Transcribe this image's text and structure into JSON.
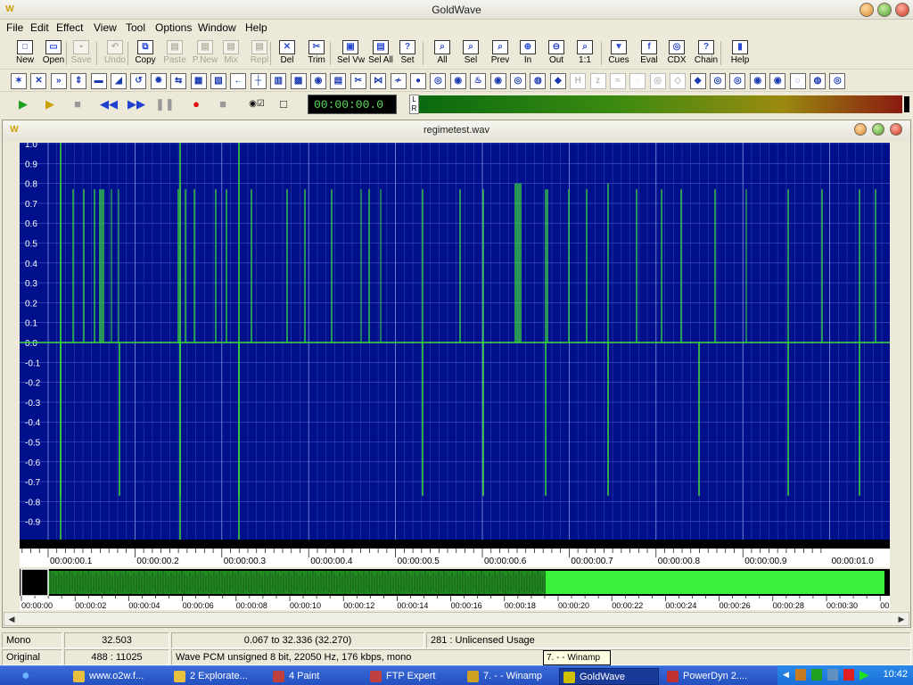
{
  "app": {
    "title": "GoldWave",
    "icon_glyph": "W"
  },
  "menu": [
    "File",
    "Edit",
    "Effect",
    "View",
    "Tool",
    "Options",
    "Window",
    "Help"
  ],
  "toolbar": [
    {
      "label": "New",
      "icon": "new-file-icon",
      "glyph": "□",
      "enabled": true
    },
    {
      "label": "Open",
      "icon": "open-folder-icon",
      "glyph": "▭",
      "enabled": true
    },
    {
      "label": "Save",
      "icon": "save-disk-icon",
      "glyph": "▪",
      "enabled": false
    },
    {
      "label": "Undo",
      "icon": "undo-icon",
      "glyph": "↶",
      "enabled": false
    },
    {
      "label": "Copy",
      "icon": "copy-icon",
      "glyph": "⧉",
      "enabled": true
    },
    {
      "label": "Paste",
      "icon": "paste-icon",
      "glyph": "▤",
      "enabled": false
    },
    {
      "label": "P.New",
      "icon": "paste-new-icon",
      "glyph": "▤",
      "enabled": false
    },
    {
      "label": "Mix",
      "icon": "mix-icon",
      "glyph": "▤",
      "enabled": false
    },
    {
      "label": "Repl",
      "icon": "replace-icon",
      "glyph": "▤",
      "enabled": false
    },
    {
      "label": "Del",
      "icon": "delete-icon",
      "glyph": "✕",
      "enabled": true
    },
    {
      "label": "Trim",
      "icon": "trim-icon",
      "glyph": "✂",
      "enabled": true
    },
    {
      "label": "Sel Vw",
      "icon": "select-view-icon",
      "glyph": "▣",
      "enabled": true
    },
    {
      "label": "Sel All",
      "icon": "select-all-icon",
      "glyph": "▤",
      "enabled": true
    },
    {
      "label": "Set",
      "icon": "set-selection-icon",
      "glyph": "?",
      "enabled": true
    },
    {
      "label": "All",
      "icon": "zoom-all-icon",
      "glyph": "⌕",
      "enabled": true
    },
    {
      "label": "Sel",
      "icon": "zoom-selection-icon",
      "glyph": "⌕",
      "enabled": true
    },
    {
      "label": "Prev",
      "icon": "zoom-previous-icon",
      "glyph": "⌕",
      "enabled": true
    },
    {
      "label": "In",
      "icon": "zoom-in-icon",
      "glyph": "⊕",
      "enabled": true
    },
    {
      "label": "Out",
      "icon": "zoom-out-icon",
      "glyph": "⊖",
      "enabled": true
    },
    {
      "label": "1:1",
      "icon": "zoom-1to1-icon",
      "glyph": "⌕",
      "enabled": true
    },
    {
      "label": "Cues",
      "icon": "cues-icon",
      "glyph": "▼",
      "enabled": true
    },
    {
      "label": "Eval",
      "icon": "eval-icon",
      "glyph": "f",
      "enabled": true
    },
    {
      "label": "CDX",
      "icon": "cd-extract-icon",
      "glyph": "◎",
      "enabled": true
    },
    {
      "label": "Chain",
      "icon": "chain-icon",
      "glyph": "?",
      "enabled": true
    },
    {
      "label": "Help",
      "icon": "help-book-icon",
      "glyph": "▮",
      "enabled": true
    }
  ],
  "effects_toolbar_count": 42,
  "transport": {
    "time": "00:00:00.0",
    "lr_label": "L R"
  },
  "document": {
    "title": "regimetest.wav"
  },
  "waveform": {
    "y_ticks": [
      "1.0",
      "0.9",
      "0.8",
      "0.7",
      "0.6",
      "0.5",
      "0.4",
      "0.3",
      "0.2",
      "0.1",
      "0.0",
      "-0.1",
      "-0.2",
      "-0.3",
      "-0.4",
      "-0.5",
      "-0.6",
      "-0.7",
      "-0.8",
      "-0.9"
    ],
    "x_ticks": [
      "00:00:00.1",
      "00:00:00.2",
      "00:00:00.3",
      "00:00:00.4",
      "00:00:00.5",
      "00:00:00.6",
      "00:00:00.7",
      "00:00:00.8",
      "00:00:00.9",
      "00:00:01.0"
    ],
    "bg_color": "#000f8c",
    "wave_color": "#3cdc3c"
  },
  "overview": {
    "x_ticks": [
      "00:00:00",
      "00:00:02",
      "00:00:04",
      "00:00:06",
      "00:00:08",
      "00:00:10",
      "00:00:12",
      "00:00:14",
      "00:00:16",
      "00:00:18",
      "00:00:20",
      "00:00:22",
      "00:00:24",
      "00:00:26",
      "00:00:28",
      "00:00:30",
      "00:0"
    ]
  },
  "status": {
    "channel": "Mono",
    "length": "32.503",
    "range": "0.067 to 32.336 (32.270)",
    "license": "281 : Unlicensed Usage",
    "mode": "Original",
    "zoom": "488 : 11025",
    "format": "Wave PCM unsigned 8 bit, 22050 Hz, 176 kbps, mono"
  },
  "tooltip": "7. - - Winamp",
  "taskbar": {
    "items": [
      {
        "label": "www.o2w.f...",
        "color": "#e8c040"
      },
      {
        "label": "2 Explorate...",
        "color": "#e8c040"
      },
      {
        "label": "4 Paint",
        "color": "#c04040"
      },
      {
        "label": "FTP Expert",
        "color": "#c04040"
      },
      {
        "label": "7. - - Winamp",
        "color": "#d0a020"
      },
      {
        "label": "GoldWave",
        "color": "#d0c000"
      },
      {
        "label": "PowerDyn 2....",
        "color": "#c03030"
      }
    ],
    "active_index": 5,
    "clock": "10:42"
  }
}
